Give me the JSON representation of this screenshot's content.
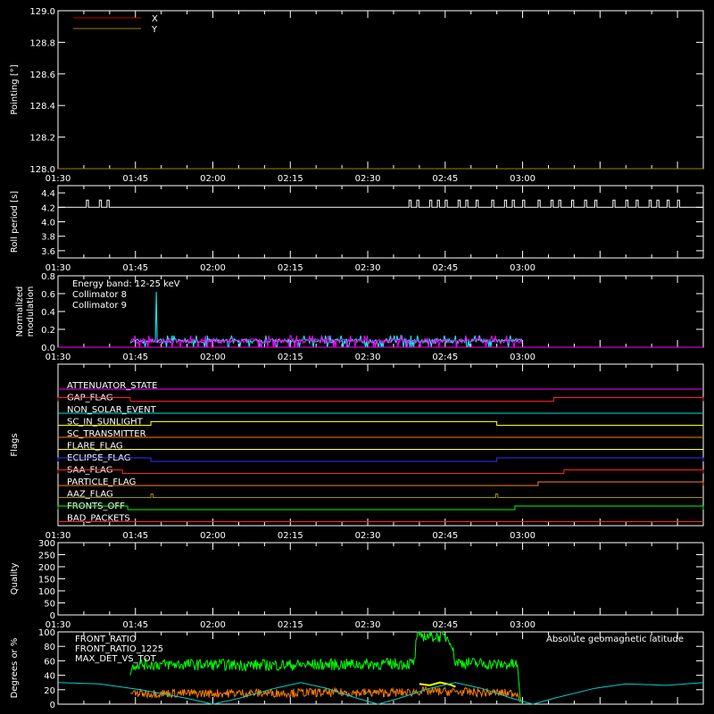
{
  "time_ticks": [
    "01:30",
    "01:45",
    "02:00",
    "02:15",
    "02:30",
    "02:45",
    "03:00"
  ],
  "chart_data": [
    {
      "type": "line",
      "id": "pointing",
      "ylabel": "Pointing [°]",
      "ylim": [
        128.0,
        129.0
      ],
      "y_ticks": [
        "128.0",
        "128.2",
        "128.4",
        "128.6",
        "128.8",
        "129.0"
      ],
      "legend": [
        "X",
        "Y"
      ],
      "series": [
        {
          "name": "X",
          "color": "#c00000",
          "points": []
        },
        {
          "name": "Y",
          "color": "#a08000",
          "points": [
            [
              0,
              128.0
            ],
            [
              125,
              128.0
            ]
          ]
        }
      ]
    },
    {
      "type": "line",
      "id": "roll",
      "ylabel": "Roll period [s]",
      "ylim": [
        3.5,
        4.5
      ],
      "y_ticks": [
        "3.6",
        "3.8",
        "4.0",
        "4.2",
        "4.4"
      ],
      "baseline": 4.2,
      "spike_value": 4.3,
      "spike_times": [
        5.5,
        8,
        9.5,
        68,
        69.5,
        72,
        73.5,
        75,
        77.5,
        79,
        81,
        84,
        86.5,
        88,
        90,
        93,
        95.5,
        97,
        99.5,
        102,
        104,
        107.5,
        110,
        112,
        114.5,
        116,
        118,
        120
      ]
    },
    {
      "type": "line",
      "id": "modulation",
      "ylabel": "Normalized modulation",
      "ylim": [
        0.0,
        0.8
      ],
      "y_ticks": [
        "0.0",
        "0.2",
        "0.4",
        "0.6",
        "0.8"
      ],
      "annotation": "Energy band: 12-25 keV",
      "time_range": [
        14,
        90
      ],
      "series": [
        {
          "name": "Collimator 8",
          "color": "#00ffff",
          "typical": 0.07,
          "peak": {
            "t": 19,
            "v": 0.62
          }
        },
        {
          "name": "Collimator 9",
          "color": "#ff00ff",
          "typical": 0.07
        }
      ]
    },
    {
      "type": "line",
      "id": "flags",
      "ylabel": "Flags",
      "flags": [
        {
          "name": "ATTENUATOR_STATE",
          "color": "#ff00ff",
          "segments": []
        },
        {
          "name": "GAP_FLAG",
          "color": "#ff2020",
          "segments": [
            [
              0,
              14
            ],
            [
              96,
              125
            ]
          ]
        },
        {
          "name": "NON_SOLAR_EVENT",
          "color": "#00e0e0",
          "segments": []
        },
        {
          "name": "SC_IN_SUNLIGHT",
          "color": "#ffff00",
          "segments": [
            [
              18,
              85
            ]
          ]
        },
        {
          "name": "SC_TRANSMITTER",
          "color": "#ff8000",
          "segments": []
        },
        {
          "name": "FLARE_FLAG",
          "color": "#ffff60",
          "segments": []
        },
        {
          "name": "ECLIPSE_FLAG",
          "color": "#3030ff",
          "segments": [
            [
              0,
              18
            ],
            [
              85,
              125
            ]
          ]
        },
        {
          "name": "SAA_FLAG",
          "color": "#ff2020",
          "segments": [
            [
              0,
              12.5
            ],
            [
              98,
              125
            ]
          ]
        },
        {
          "name": "PARTICLE_FLAG",
          "color": "#ff8020",
          "segments": [
            [
              93,
              125
            ]
          ]
        },
        {
          "name": "AAZ_FLAG",
          "color": "#a09000",
          "segments": [
            [
              18,
              18.4
            ],
            [
              84.8,
              85.2
            ]
          ]
        },
        {
          "name": "FRONTS_OFF",
          "color": "#00ff00",
          "segments": [
            [
              0,
              13.5
            ],
            [
              88.5,
              125
            ]
          ]
        },
        {
          "name": "BAD_PACKETS",
          "color": "#ff2020",
          "segments": []
        }
      ]
    },
    {
      "type": "line",
      "id": "quality",
      "ylabel": "Quality",
      "ylim": [
        0,
        300
      ],
      "y_ticks": [
        "0",
        "50",
        "100",
        "150",
        "200",
        "250",
        "300"
      ],
      "series": []
    },
    {
      "type": "line",
      "id": "front_ratio",
      "ylabel": "Degrees or %",
      "ylim": [
        0,
        100
      ],
      "y_ticks": [
        "0",
        "20",
        "40",
        "60",
        "80",
        "100"
      ],
      "annotation": "Absolute geomagnetic latitude",
      "series": [
        {
          "name": "FRONT_RATIO",
          "color": "#ffff00",
          "points": [
            [
              70,
              28
            ],
            [
              72,
              26
            ],
            [
              74,
              30
            ],
            [
              76,
              27
            ],
            [
              77,
              24
            ]
          ]
        },
        {
          "name": "FRONT_RATIO_1225",
          "color": "#00ff00",
          "points": [
            [
              14,
              40
            ],
            [
              14.5,
              55
            ],
            [
              25,
              55
            ],
            [
              40,
              54
            ],
            [
              55,
              55
            ],
            [
              68,
              56
            ],
            [
              69,
              57
            ],
            [
              69.5,
              95
            ],
            [
              75,
              93
            ],
            [
              76,
              90
            ],
            [
              77,
              58
            ],
            [
              85,
              55
            ],
            [
              89,
              55
            ],
            [
              89.5,
              10
            ],
            [
              90,
              0
            ]
          ]
        },
        {
          "name": "MAX_DET_VS_TOT",
          "color": "#ff8000",
          "points": [
            [
              14,
              15
            ],
            [
              30,
              15
            ],
            [
              50,
              16
            ],
            [
              68,
              16
            ],
            [
              70,
              18
            ],
            [
              78,
              17
            ],
            [
              89,
              15
            ],
            [
              89.5,
              3
            ]
          ]
        },
        {
          "name": "Absolute geomagnetic latitude",
          "color": "#00d0d0",
          "points": [
            [
              0,
              30
            ],
            [
              8,
              28
            ],
            [
              16,
              20
            ],
            [
              25,
              8
            ],
            [
              30,
              0
            ],
            [
              35,
              8
            ],
            [
              42,
              22
            ],
            [
              47,
              30
            ],
            [
              52,
              22
            ],
            [
              58,
              8
            ],
            [
              62,
              0
            ],
            [
              66,
              8
            ],
            [
              72,
              22
            ],
            [
              77,
              30
            ],
            [
              82,
              22
            ],
            [
              88,
              8
            ],
            [
              92,
              0
            ],
            [
              96,
              8
            ],
            [
              104,
              22
            ],
            [
              110,
              28
            ],
            [
              118,
              26
            ],
            [
              125,
              30
            ]
          ]
        }
      ]
    }
  ]
}
